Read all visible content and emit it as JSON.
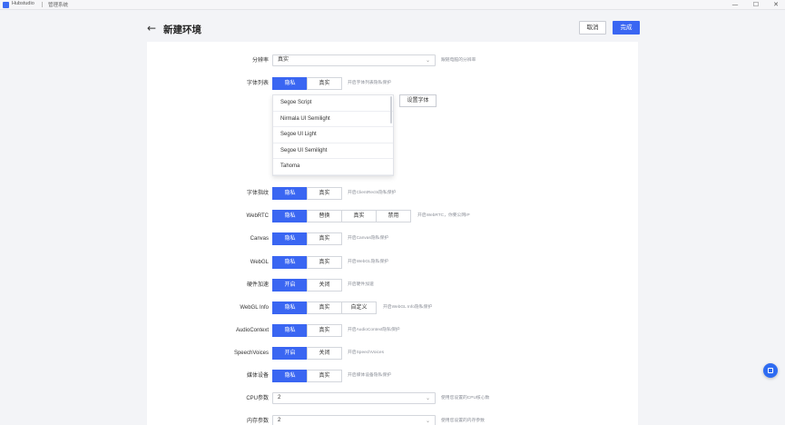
{
  "titlebar": {
    "app_name": "Hubstudio",
    "subtitle": "管理系统",
    "minimize": "—",
    "maximize": "☐",
    "close": "✕"
  },
  "header": {
    "back": "←",
    "title": "新建环境",
    "cancel": "取消",
    "done": "完成"
  },
  "rows": {
    "resolution": {
      "label": "分辨率",
      "value": "真实",
      "hint": "跟随电脑的分辨率"
    },
    "font_list": {
      "label": "字体列表",
      "options": [
        "隐私",
        "真实"
      ],
      "hint": "开启字体列表隐私保护",
      "set_font": "设置字体",
      "fonts": [
        "Segoe Script",
        "Nirmala UI Semilight",
        "Segoe UI Light",
        "Segoe UI Semilight",
        "Tahoma"
      ]
    },
    "font_fingerprint": {
      "label": "字体指纹",
      "options": [
        "隐私",
        "真实"
      ],
      "hint": "开启ClientRects隐私保护"
    },
    "webrtc": {
      "label": "WebRTC",
      "options": [
        "隐私",
        "替换",
        "真实",
        "禁用"
      ],
      "hint": "开启WebRTC，你要公网IP"
    },
    "canvas": {
      "label": "Canvas",
      "options": [
        "隐私",
        "真实"
      ],
      "hint": "开启Canvas隐私保护"
    },
    "webgl": {
      "label": "WebGL",
      "options": [
        "隐私",
        "真实"
      ],
      "hint": "开启WebGL隐私保护"
    },
    "hw_accel": {
      "label": "硬件加速",
      "options": [
        "开启",
        "关闭"
      ],
      "hint": "开启硬件加速"
    },
    "webgl_info": {
      "label": "WebGL Info",
      "options": [
        "隐私",
        "真实",
        "自定义"
      ],
      "hint": "开启WebGL Info隐私保护"
    },
    "audio_context": {
      "label": "AudioContext",
      "options": [
        "隐私",
        "真实"
      ],
      "hint": "开启AudioContext隐私保护"
    },
    "speech_voices": {
      "label": "SpeechVoices",
      "options": [
        "开启",
        "关闭"
      ],
      "hint": "开启SpeechVoices"
    },
    "media_devices": {
      "label": "媒体设备",
      "options": [
        "隐私",
        "真实"
      ],
      "hint": "开启媒体设备隐私保护"
    },
    "cpu": {
      "label": "CPU参数",
      "value": "2",
      "hint": "使用您设置的CPU核心数"
    },
    "memory": {
      "label": "内存参数",
      "value": "2",
      "hint": "使用您设置的内存参数"
    }
  },
  "chevron": "⌄",
  "accent_color": "#3a66f2"
}
